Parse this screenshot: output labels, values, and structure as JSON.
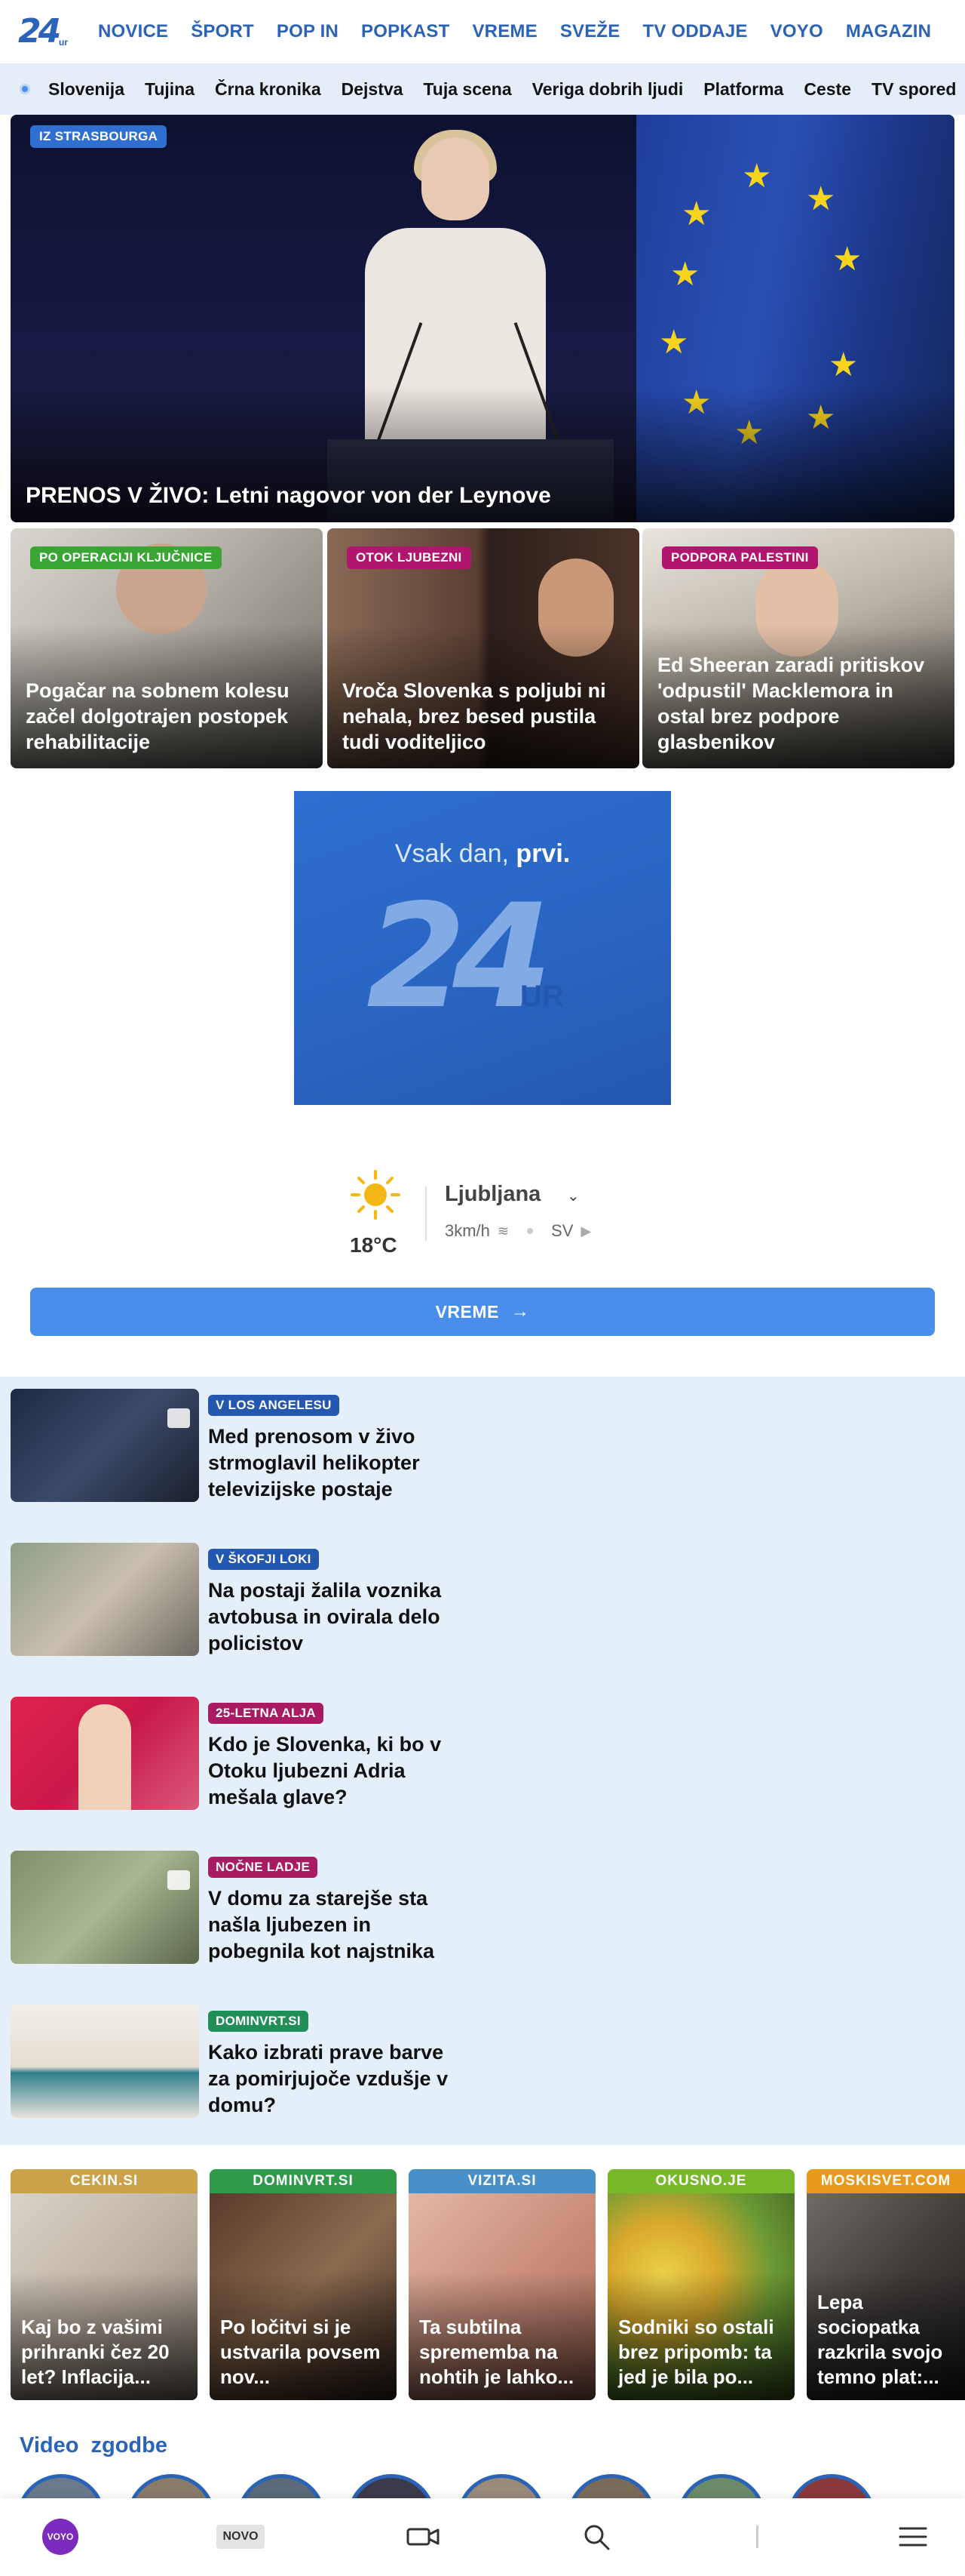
{
  "header": {
    "logo": "24",
    "logo_suffix": "ur",
    "nav": [
      "NOVICE",
      "ŠPORT",
      "POP IN",
      "POPKAST",
      "VREME",
      "SVEŽE",
      "TV ODDAJE",
      "VOYO",
      "MAGAZIN"
    ]
  },
  "subnav": {
    "items": [
      "Slovenija",
      "Tujina",
      "Črna kronika",
      "Dejstva",
      "Tuja scena",
      "Veriga dobrih ljudi",
      "Platforma",
      "Ceste",
      "TV spored"
    ]
  },
  "hero": {
    "tag": "IZ STRASBOURGA",
    "title": "PRENOS V ŽIVO: Letni nagovor von der Leynove"
  },
  "cards": [
    {
      "tag": "PO OPERACIJI KLJUČNICE",
      "title": "Pogačar na sobnem kolesu začel dolgotrajen postopek rehabilitacije"
    },
    {
      "tag": "OTOK LJUBEZNI",
      "title": "Vroča Slovenka s poljubi ni nehala, brez besed pustila tudi voditeljico"
    },
    {
      "tag": "PODPORA PALESTINI",
      "title": "Ed Sheeran zaradi pritiskov 'odpustil' Macklemora in ostal brez podpore glasbenikov"
    }
  ],
  "ad": {
    "slogan_prefix": "Vsak dan, ",
    "slogan_bold": "prvi.",
    "logo_number": "24",
    "logo_suffix": "UR"
  },
  "weather": {
    "icon": "sun-icon",
    "temperature": "18°C",
    "city": "Ljubljana",
    "wind_speed": "3km/h",
    "wind_direction": "SV",
    "button_label": "VREME"
  },
  "list": [
    {
      "tag": "V LOS ANGELESU",
      "title": "Med prenosom v živo strmoglavil helikopter televizijske postaje",
      "gallery": true
    },
    {
      "tag": "V ŠKOFJI LOKI",
      "title": "Na postaji žalila voznika avtobusa in ovirala delo policistov",
      "gallery": false
    },
    {
      "tag": "25-LETNA ALJA",
      "title": "Kdo je Slovenka, ki bo v Otoku ljubezni Adria mešala glave?",
      "gallery": false
    },
    {
      "tag": "NOČNE LADJE",
      "title": "V domu za starejše sta našla ljubezen in pobegnila kot najstnika",
      "gallery": true
    },
    {
      "tag": "DOMINVRT.SI",
      "title": "Kako izbrati prave barve za pomirjujoče vzdušje v domu?",
      "gallery": false
    }
  ],
  "partners": [
    {
      "source": "CEKIN.SI",
      "title": "Kaj bo z vašimi prihranki čez 20 let? Inflacija...",
      "color": "#c9a24a"
    },
    {
      "source": "DOMINVRT.SI",
      "title": "Po ločitvi si je ustvarila povsem nov...",
      "color": "#2e9a4a"
    },
    {
      "source": "VIZITA.SI",
      "title": "Ta subtilna sprememba na nohtih je lahko...",
      "color": "#4a90c8"
    },
    {
      "source": "OKUSNO.JE",
      "title": "Sodniki so ostali brez pripomb: ta jed je bila po...",
      "color": "#78b82a"
    },
    {
      "source": "MOSKISVET.COM",
      "title": "Lepa sociopatka razkrila svojo temno plat:...",
      "color": "#e89a1c"
    }
  ],
  "video_stories": {
    "title": "Video zgodbe"
  },
  "bottombar": {
    "voyo": "VOYO",
    "novo": "NOVO"
  }
}
